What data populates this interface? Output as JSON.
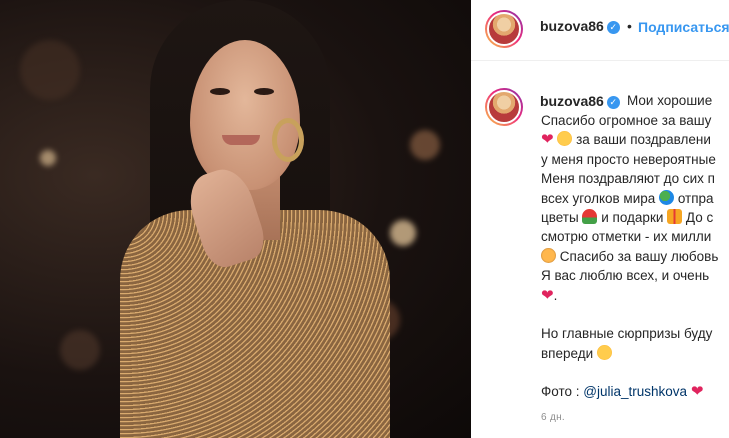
{
  "post": {
    "username": "buzova86",
    "verified_icon": "verified-badge-icon",
    "separator": "•",
    "follow_label": "Подписаться",
    "caption": {
      "first_line_rest": "Мои хорошие",
      "lines": [
        "Спасибо огромное за вашу",
        "за ваши поздравлени",
        "у меня просто невероятные",
        "Меня поздравляют до сих п",
        "всех уголков мира",
        "отпра",
        "цветы",
        "и подарки",
        "До с",
        "смотрю отметки - их милли",
        "Спасибо за вашу любовь",
        "Я вас люблю всех, и очень",
        "."
      ],
      "p2_line1": "Но главные сюрпризы буду",
      "p2_line2": "впереди",
      "photo_credit_prefix": "Фото :",
      "photo_credit_mention": "@julia_trushkova"
    },
    "timestamp": "6 дн.",
    "colors": {
      "link": "#3897f0",
      "mention": "#003569",
      "heart": "#e0245e"
    }
  }
}
